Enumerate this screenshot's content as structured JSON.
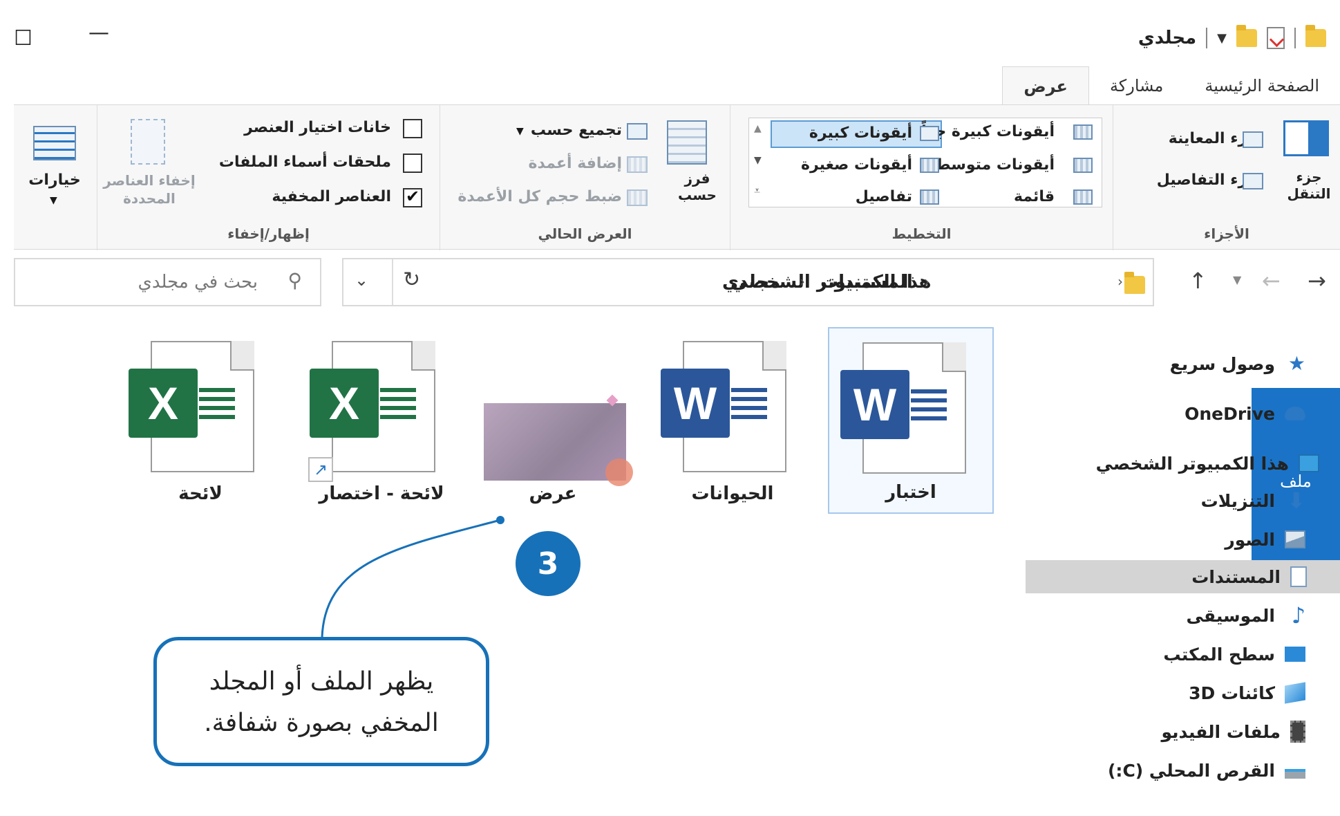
{
  "window": {
    "title": "مجلدي",
    "maximize_glyph": "☐",
    "minimize_glyph": "—"
  },
  "tabs": [
    {
      "label": "ملف"
    },
    {
      "label": "الصفحة الرئيسية"
    },
    {
      "label": "مشاركة"
    },
    {
      "label": "عرض"
    }
  ],
  "ribbon": {
    "panes": {
      "group_label": "الأجزاء",
      "nav_pane": "جزء التنقل",
      "preview_pane": "جزء المعاينة",
      "details_pane": "جزء التفاصيل"
    },
    "layout": {
      "group_label": "التخطيط",
      "extra_large": "أيقونات كبيرة جداً",
      "large": "أيقونات كبيرة",
      "medium": "أيقونات متوسطة",
      "small": "أيقونات صغيرة",
      "list": "قائمة",
      "details": "تفاصيل",
      "selected": "large"
    },
    "current_view": {
      "group_label": "العرض الحالي",
      "sort_by": "فرز حسب",
      "group_by": "تجميع حسب",
      "add_columns": "إضافة أعمدة",
      "size_columns": "ضبط حجم كل الأعمدة"
    },
    "show_hide": {
      "group_label": "إظهار/إخفاء",
      "item_checkboxes": "خانات اختيار العنصر",
      "item_checkboxes_checked": false,
      "file_extensions": "ملحقات أسماء الملفات",
      "file_extensions_checked": false,
      "hidden_items": "العناصر المخفية",
      "hidden_items_checked": true,
      "hide_selected": "إخفاء العناصر المحددة"
    },
    "options": "خيارات"
  },
  "address": {
    "crumbs": [
      "هذا الكمبيوتر الشخصي",
      "المستندات",
      "مجلدي"
    ],
    "search_placeholder": "بحث في مجلدي"
  },
  "sidebar": {
    "items": [
      {
        "label": "وصول سريع",
        "icon": "star-icon"
      },
      {
        "label": "OneDrive",
        "icon": "cloud-icon"
      },
      {
        "label": "هذا الكمبيوتر الشخصي",
        "icon": "computer-icon"
      },
      {
        "label": "التنزيلات",
        "icon": "download-icon"
      },
      {
        "label": "الصور",
        "icon": "pictures-icon"
      },
      {
        "label": "المستندات",
        "icon": "documents-icon",
        "selected": true
      },
      {
        "label": "الموسيقى",
        "icon": "music-icon"
      },
      {
        "label": "سطح المكتب",
        "icon": "desktop-icon"
      },
      {
        "label": "كائنات 3D",
        "icon": "3d-objects-icon"
      },
      {
        "label": "ملفات الفيديو",
        "icon": "video-icon"
      },
      {
        "label": "القرص المحلي (C:)",
        "icon": "drive-icon"
      }
    ]
  },
  "files": [
    {
      "name": "اختبار",
      "type": "word",
      "selected": true,
      "badge": "W"
    },
    {
      "name": "الحيوانات",
      "type": "word",
      "badge": "W"
    },
    {
      "name": "عرض",
      "type": "powerpoint-hidden"
    },
    {
      "name": "لائحة - اختصار",
      "type": "excel-shortcut",
      "badge": "X"
    },
    {
      "name": "لائحة",
      "type": "excel",
      "badge": "X"
    }
  ],
  "callout": {
    "step": "3",
    "line1": "يظهر الملف أو المجلد",
    "line2": "المخفي بصورة شفافة."
  },
  "colors": {
    "accent": "#1771b8",
    "file_tab": "#1a73c6",
    "word": "#2b579a",
    "excel": "#217346"
  }
}
